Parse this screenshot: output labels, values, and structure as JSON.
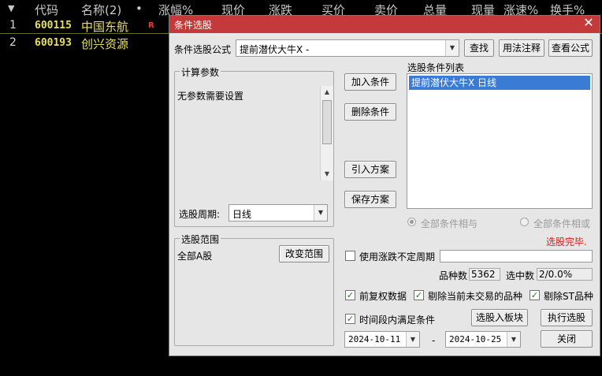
{
  "table": {
    "columns": [
      "代码",
      "名称(2)",
      "•",
      "涨幅%",
      "现价",
      "涨跌",
      "买价",
      "卖价",
      "总量",
      "现量",
      "涨速%",
      "换手%"
    ],
    "rows": [
      {
        "num": "1",
        "code": "600115",
        "name": "中国东航",
        "flag": "R"
      },
      {
        "num": "2",
        "code": "600193",
        "name": "创兴资源",
        "flag": ""
      }
    ]
  },
  "dialog": {
    "title": "条件选股",
    "formula_label": "条件选股公式",
    "formula_value": "提前潜伏大牛X -",
    "find_button": "查找",
    "usage_button": "用法注释",
    "view_formula_button": "查看公式",
    "calc_params": {
      "title": "计算参数",
      "message": "无参数需要设置"
    },
    "period_label": "选股周期:",
    "period_value": "日线",
    "add_condition": "加入条件",
    "delete_condition": "删除条件",
    "import_plan": "引入方案",
    "save_plan": "保存方案",
    "condition_list_label": "选股条件列表",
    "condition_items": [
      "提前潜伏大牛X  日线"
    ],
    "radio_and": "全部条件相与",
    "radio_or": "全部条件相或",
    "status_text": "选股完毕.",
    "range": {
      "title": "选股范围",
      "value": "全部A股",
      "change_button": "改变范围"
    },
    "use_uncertain_period": "使用涨跌不定周期",
    "count_label": "品种数",
    "count_value": "5362",
    "selected_label": "选中数",
    "selected_value": "2/0.0%",
    "check_prev_adjust": "前复权数据",
    "check_remove_untraded": "剔除当前未交易的品种",
    "check_remove_st": "剔除ST品种",
    "check_time_range": "时间段内满足条件",
    "to_block_button": "选股入板块",
    "execute_button": "执行选股",
    "date_from": "2024-10-11",
    "date_sep": "-",
    "date_to": "2024-10-25",
    "close_button": "关闭"
  },
  "icons": {
    "menu_arrow": "triangle-down-icon",
    "close": "close-icon",
    "check": "checkmark-icon"
  },
  "colors": {
    "title_bar": "#c43a3a",
    "selection": "#3a7bd6",
    "status_red": "#e01818",
    "stock_yellow": "#e8e060"
  }
}
